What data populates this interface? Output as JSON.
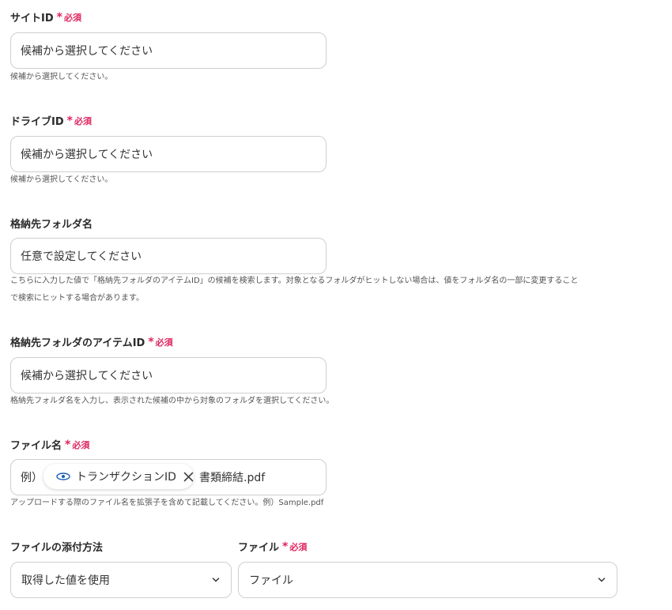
{
  "required_text": "必須",
  "required_mark": "*",
  "site_id": {
    "label": "サイトID",
    "placeholder": "候補から選択してください",
    "help": "候補から選択してください。"
  },
  "drive_id": {
    "label": "ドライブID",
    "placeholder": "候補から選択してください",
    "help": "候補から選択してください。"
  },
  "folder_name": {
    "label": "格納先フォルダ名",
    "placeholder": "任意で設定してください",
    "help_line1": "こちらに入力した値で「格納先フォルダのアイテムID」の候補を検索します。対象となるフォルダがヒットしない場合は、値をフォルダ名の一部に変更すること",
    "help_line2": "で検索にヒットする場合があります。"
  },
  "folder_item_id": {
    "label": "格納先フォルダのアイテムID",
    "placeholder": "候補から選択してください",
    "help": "格納先フォルダ名を入力し、表示された候補の中から対象のフォルダを選択してください。"
  },
  "file_name": {
    "label": "ファイル名",
    "prefix": "例）",
    "chip_label": "トランザクションID",
    "suffix": "書類締結.pdf",
    "help": "アップロードする際のファイル名を拡張子を含めて記載してください。例）Sample.pdf"
  },
  "attach_method": {
    "label": "ファイルの添付方法",
    "value": "取得した値を使用"
  },
  "file": {
    "label": "ファイル",
    "value": "ファイル"
  },
  "colors": {
    "required": "#e0245e",
    "border": "#cfcfd4"
  }
}
